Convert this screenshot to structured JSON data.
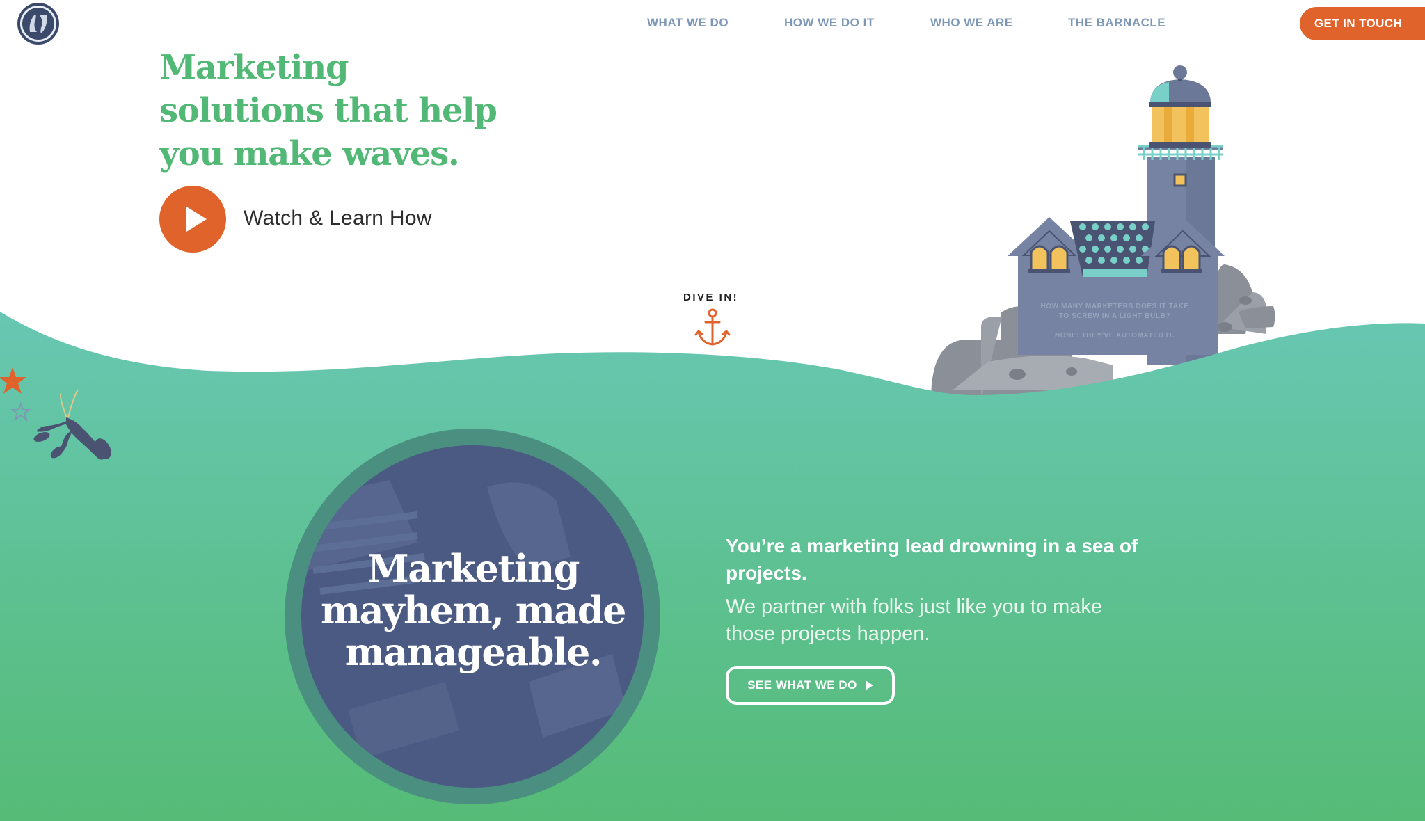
{
  "nav": {
    "links": [
      {
        "label": "WHAT WE DO"
      },
      {
        "label": "HOW WE DO IT"
      },
      {
        "label": "WHO WE ARE"
      },
      {
        "label": "THE BARNACLE"
      }
    ],
    "cta_label": "GET IN TOUCH"
  },
  "hero": {
    "title": "Marketing solutions that help you make waves.",
    "watch_label": "Watch & Learn How",
    "dive_label": "DIVE IN!"
  },
  "lighthouse": {
    "joke_question_line1": "HOW MANY MARKETERS DOES IT TAKE",
    "joke_question_line2": "TO SCREW IN A LIGHT BULB?",
    "joke_answer": "NONE: THEY'VE AUTOMATED IT."
  },
  "feature": {
    "circle_title": "Marketing mayhem, made manageable.",
    "lead": "You’re a marketing lead drowning in a sea of projects.",
    "sub": "We partner with folks just like you to make those projects happen.",
    "button_label": "SEE WHAT WE DO"
  },
  "colors": {
    "brand_green": "#52b876",
    "sea_top": "#67c7b2",
    "sea_bottom": "#55bb76",
    "accent_orange": "#e1632c",
    "nav_blue": "#7c98b6",
    "circle_navy": "#4a5a82"
  },
  "icons": [
    "logo-icon",
    "play-icon",
    "anchor-icon",
    "starfish-icon",
    "lobster-icon",
    "lighthouse-icon",
    "play-triangle-icon"
  ]
}
